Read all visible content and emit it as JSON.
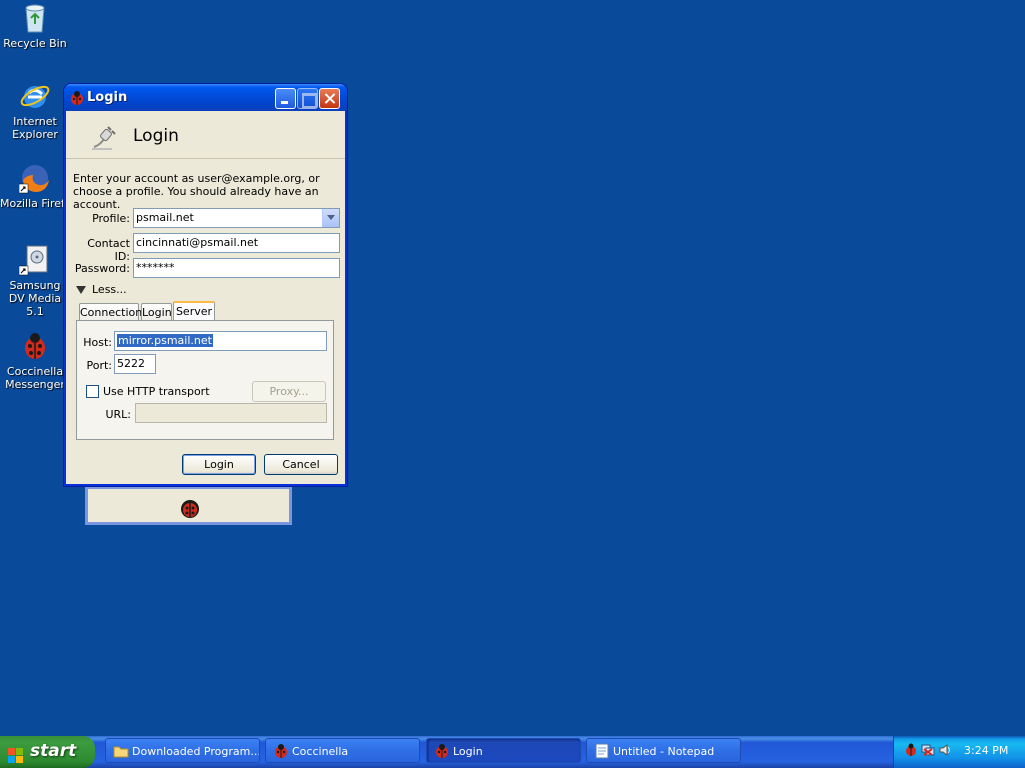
{
  "desktop": {
    "icons": [
      {
        "label": "Recycle Bin",
        "icon": "recycle-bin-icon"
      },
      {
        "label": "Internet Explorer",
        "icon": "internet-explorer-icon"
      },
      {
        "label": "Mozilla Firefo",
        "icon": "firefox-icon"
      },
      {
        "label": "Samsung DV Media 5.1",
        "icon": "samsung-dvd-icon"
      },
      {
        "label": "Coccinella Messenger",
        "icon": "coccinella-icon"
      }
    ]
  },
  "window": {
    "title": "Login",
    "header_title": "Login",
    "intro": "Enter your account as user@example.org, or choose a profile. You should already have an account.",
    "profile_label": "Profile:",
    "profile_value": "psmail.net",
    "contact_label": "Contact ID:",
    "contact_value": "cincinnati@psmail.net",
    "password_label": "Password:",
    "password_value": "*******",
    "less_label": "Less...",
    "tabs": [
      {
        "label": "Connection"
      },
      {
        "label": "Login"
      },
      {
        "label": "Server",
        "active": true
      }
    ],
    "server": {
      "host_label": "Host:",
      "host_value": "mirror.psmail.net",
      "port_label": "Port:",
      "port_value": "5222",
      "http_label": "Use HTTP transport",
      "http_checked": false,
      "proxy_label": "Proxy...",
      "url_label": "URL:",
      "url_value": ""
    },
    "login_button": "Login",
    "cancel_button": "Cancel"
  },
  "taskbar": {
    "start_label": "start",
    "tasks": [
      {
        "label": "Downloaded Program...",
        "icon": "folder-icon"
      },
      {
        "label": "Coccinella",
        "icon": "coccinella-icon"
      },
      {
        "label": "Login",
        "icon": "coccinella-icon",
        "active": true
      },
      {
        "label": "Untitled - Notepad",
        "icon": "notepad-icon"
      }
    ],
    "clock": "3:24 PM"
  },
  "colors": {
    "desktop": "#0a4a9b",
    "title_bar": "#0058ee",
    "dialog_bg": "#ece9d8",
    "selection": "#316ac5"
  }
}
